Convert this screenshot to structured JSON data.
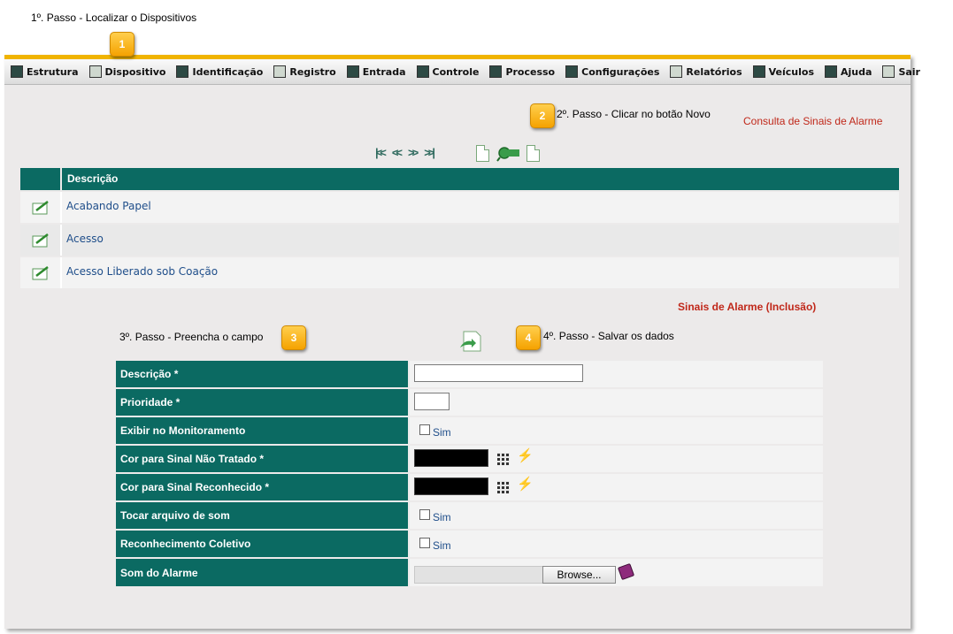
{
  "steps": {
    "step1": "1º. Passo - Localizar o Dispositivos",
    "step2": "2º. Passo - Clicar no botão Novo",
    "step3": "3º. Passo - Preencha o campo",
    "step4": "4º. Passo - Salvar os dados",
    "badges": [
      "1",
      "2",
      "3",
      "4"
    ]
  },
  "menu": {
    "items": [
      "Estrutura",
      "Dispositivo",
      "Identificação",
      "Registro",
      "Entrada",
      "Controle",
      "Processo",
      "Configurações",
      "Relatórios",
      "Veículos",
      "Ajuda",
      "Sair"
    ]
  },
  "consulta": {
    "title": "Consulta de Sinais de Alarme",
    "nav": [
      "|<<",
      "<<",
      ">>",
      ">>|"
    ],
    "column_header": "Descrição",
    "rows": [
      "Acabando Papel",
      "Acesso",
      "Acesso Liberado sob Coação"
    ]
  },
  "inclusao": {
    "title": "Sinais de Alarme (Inclusão)",
    "fields": {
      "descricao": "Descrição *",
      "prioridade": "Prioridade *",
      "exibir": "Exibir no Monitoramento",
      "cor_nao_tratado": "Cor para Sinal Não Tratado *",
      "cor_reconhecido": "Cor para Sinal Reconhecido *",
      "tocar_som": "Tocar arquivo de som",
      "reconhecimento": "Reconhecimento Coletivo",
      "som": "Som do Alarme"
    },
    "checkbox_label": "Sim",
    "browse_label": "Browse...",
    "color_value": "#000000"
  },
  "colors": {
    "accent_teal": "#0b6a62",
    "accent_gold": "#f0b400",
    "title_red": "#c0281a"
  }
}
